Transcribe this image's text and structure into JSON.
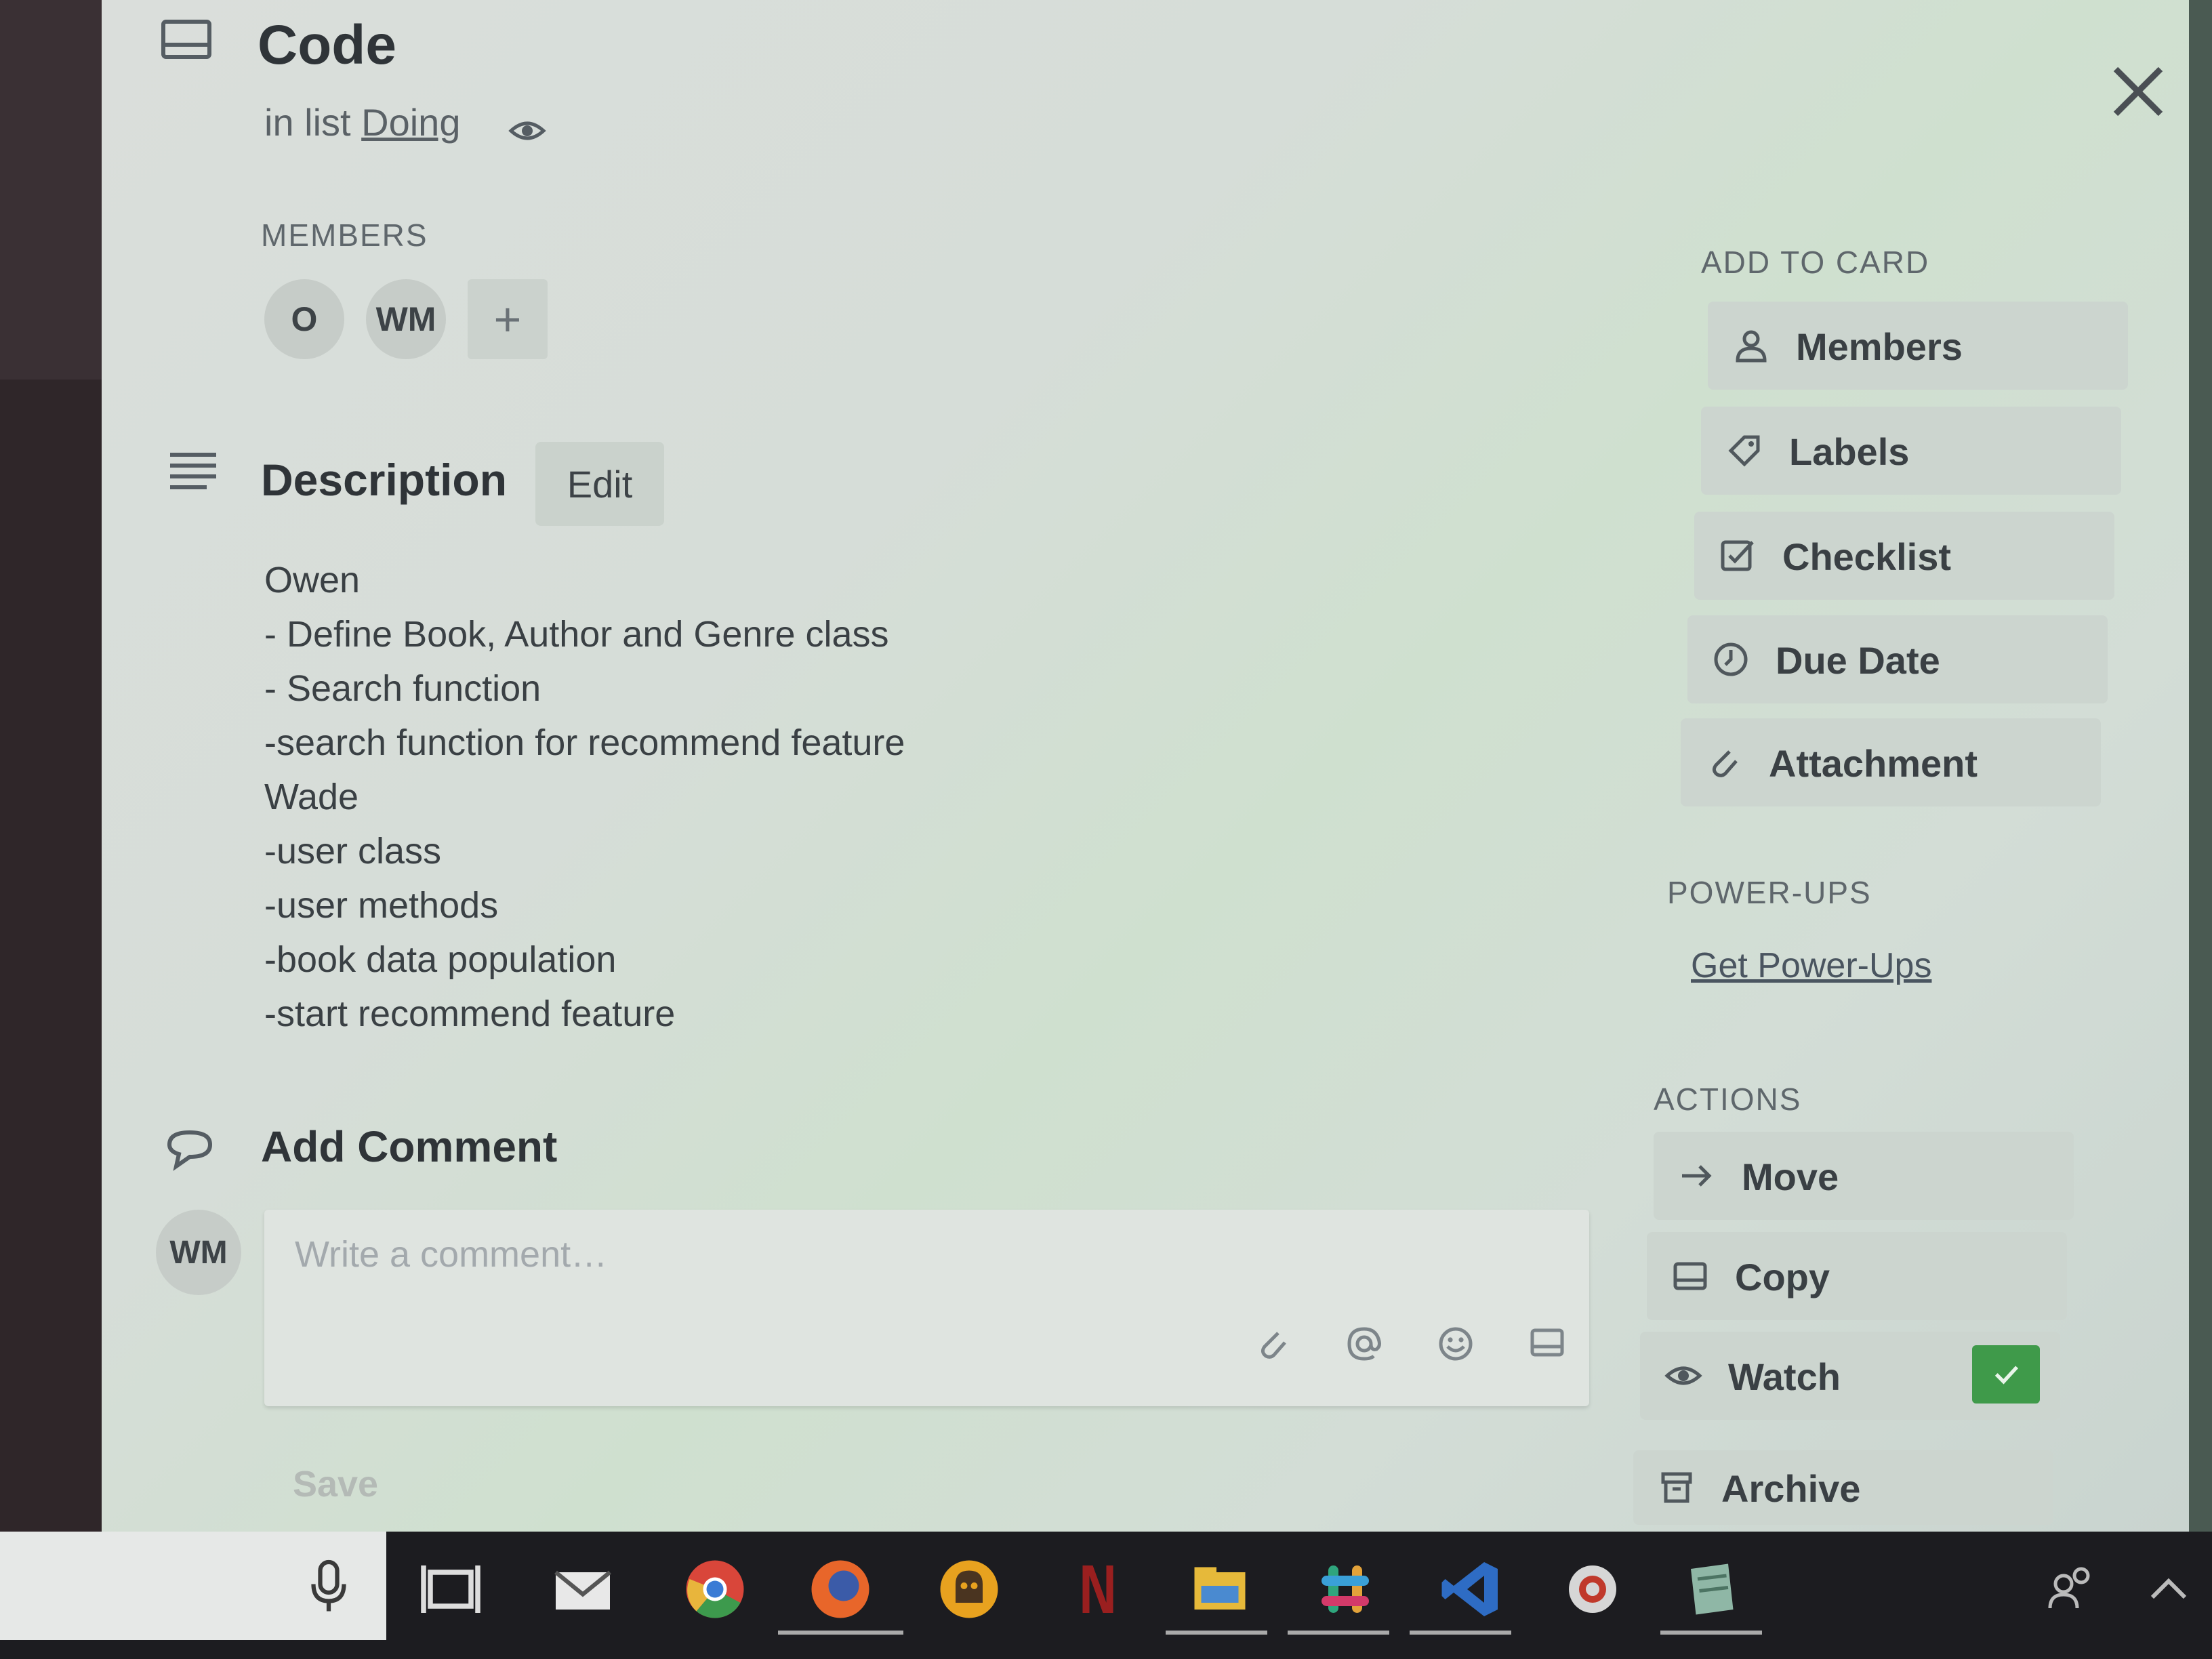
{
  "card": {
    "title": "Code",
    "in_list_prefix": "in list",
    "list_name": "Doing"
  },
  "members": {
    "label": "MEMBERS",
    "avatars": [
      "O",
      "WM"
    ],
    "add_symbol": "+"
  },
  "description": {
    "title": "Description",
    "edit_label": "Edit",
    "lines": [
      "Owen",
      "- Define Book, Author and Genre class",
      "- Search function",
      "-search function for recommend feature",
      "Wade",
      "-user class",
      "-user methods",
      "-book data population",
      "-start recommend feature"
    ]
  },
  "comment": {
    "title": "Add Comment",
    "avatar": "WM",
    "placeholder": "Write a comment…",
    "save_label": "Save"
  },
  "sidebar": {
    "add_to_card_label": "ADD TO CARD",
    "add_to_card": [
      {
        "label": "Members",
        "icon": "person-icon"
      },
      {
        "label": "Labels",
        "icon": "tag-icon"
      },
      {
        "label": "Checklist",
        "icon": "checklist-icon"
      },
      {
        "label": "Due Date",
        "icon": "clock-icon"
      },
      {
        "label": "Attachment",
        "icon": "paperclip-icon"
      }
    ],
    "powerups_label": "POWER-UPS",
    "powerups_link": "Get Power-Ups",
    "actions_label": "ACTIONS",
    "actions": [
      {
        "label": "Move",
        "icon": "arrow-right-icon"
      },
      {
        "label": "Copy",
        "icon": "card-icon"
      },
      {
        "label": "Watch",
        "icon": "eye-icon",
        "checked": true
      },
      {
        "label": "Archive",
        "icon": "archive-icon"
      }
    ]
  },
  "taskbar": {
    "apps": [
      "microphone-icon",
      "task-view-icon",
      "mail-icon",
      "chrome-icon",
      "firefox-icon",
      "ghostery-icon",
      "netflix-icon",
      "file-explorer-icon",
      "slack-icon",
      "visual-studio-icon",
      "record-icon",
      "notepad-icon",
      "people-icon",
      "chevron-up-icon"
    ]
  },
  "colors": {
    "modal_bg": "#d6ddd8",
    "button_bg": "#ccd5cf",
    "watch_check": "#3f9a4a",
    "taskbar": "#1c1c20"
  }
}
